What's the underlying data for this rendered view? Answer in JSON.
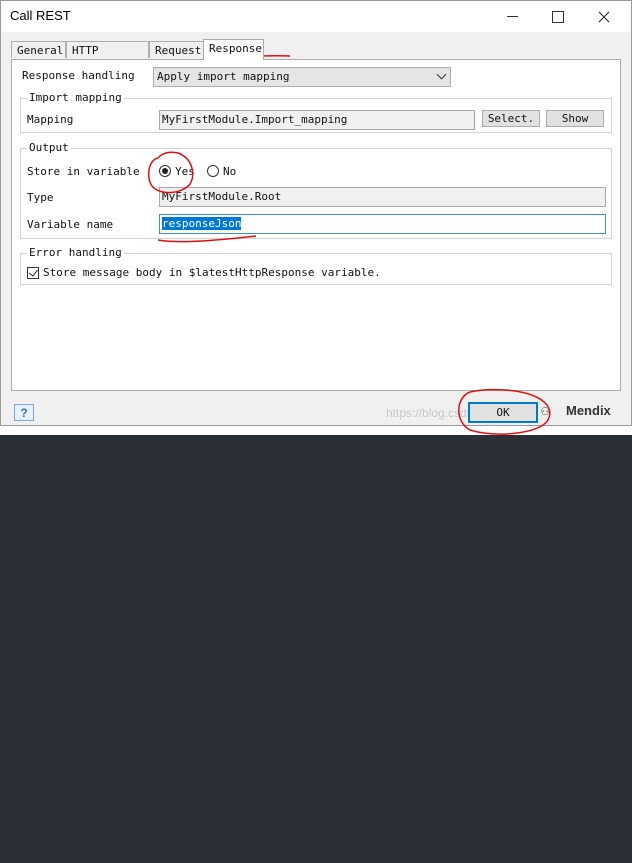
{
  "window": {
    "title": "Call REST"
  },
  "tabs": [
    {
      "label": "General"
    },
    {
      "label": "HTTP Headers"
    },
    {
      "label": "Request"
    },
    {
      "label": "Response"
    }
  ],
  "response_handling": {
    "label": "Response handling",
    "value": "Apply import mapping"
  },
  "import_mapping": {
    "title": "Import mapping",
    "mapping_label": "Mapping",
    "mapping_value": "MyFirstModule.Import_mapping",
    "select_button": "Select.",
    "show_button": "Show"
  },
  "output": {
    "title": "Output",
    "store_label": "Store in variable",
    "yes_label": "Yes",
    "no_label": "No",
    "store_selected": "Yes",
    "type_label": "Type",
    "type_value": "MyFirstModule.Root",
    "varname_label": "Variable name",
    "varname_value": "responseJson"
  },
  "error_handling": {
    "title": "Error handling",
    "checkbox_label": "Store message body in $latestHttpResponse variable.",
    "checked": true
  },
  "footer": {
    "help_label": "?",
    "ok_label": "OK",
    "watermark": "https://blog.csdn.net/...",
    "brand": "Mendix"
  },
  "background_text": "..."
}
